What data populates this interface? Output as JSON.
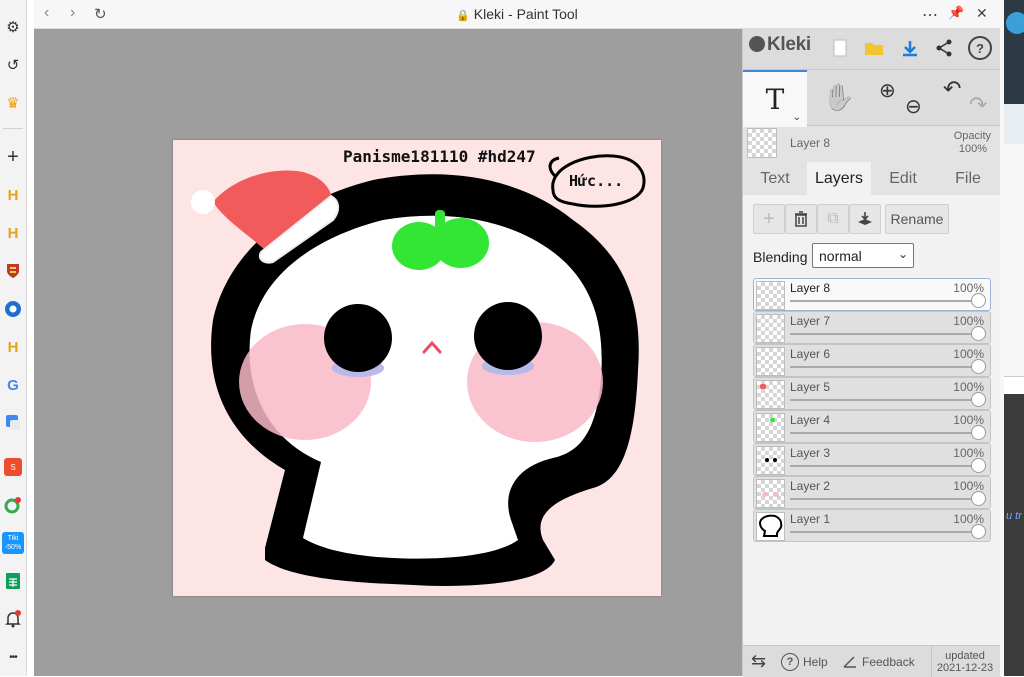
{
  "browser": {
    "window_title": "Kleki - Paint Tool",
    "back_icon": "‹",
    "forward_icon": "›",
    "reload_icon": "↻",
    "lock_icon": "🔒",
    "more_icon": "⋯",
    "pin_icon": "📌",
    "close_icon": "✕",
    "sidebar": {
      "settings_icon": "⚙",
      "history_icon": "↺",
      "crown_icon": "♛",
      "add_icon": "+",
      "more_icon": "•••",
      "h_label": "H",
      "google_label": "G",
      "shop_label": "S",
      "tiki_label": "Tiki",
      "tiki_badge": "-50%",
      "bell_icon": "🔔"
    },
    "right_strip_text": "u tr"
  },
  "app": {
    "logo": "Kleki",
    "top_icons": {
      "new": "new-file-icon",
      "open": "open-folder-icon",
      "save": "download-icon",
      "share": "share-icon",
      "help": "?"
    },
    "tools": {
      "text_tool": "T",
      "hand_tool": "✋",
      "zoom_in": "⊕",
      "zoom_out": "⊖",
      "undo": "↶",
      "redo": "↷"
    },
    "current_layer": {
      "name": "Layer 8",
      "opacity_label": "Opacity",
      "opacity_value": "100%"
    },
    "tabs": [
      "Text",
      "Layers",
      "Edit",
      "File"
    ],
    "active_tab": "Layers",
    "layer_actions": {
      "add": "+",
      "delete": "🗑",
      "duplicate": "⧉",
      "merge": "⬇",
      "rename": "Rename"
    },
    "blending": {
      "label": "Blending",
      "value": "normal"
    },
    "layers": [
      {
        "name": "Layer 8",
        "opacity": "100%",
        "selected": true
      },
      {
        "name": "Layer 7",
        "opacity": "100%",
        "selected": false
      },
      {
        "name": "Layer 6",
        "opacity": "100%",
        "selected": false
      },
      {
        "name": "Layer 5",
        "opacity": "100%",
        "selected": false
      },
      {
        "name": "Layer 4",
        "opacity": "100%",
        "selected": false
      },
      {
        "name": "Layer 3",
        "opacity": "100%",
        "selected": false
      },
      {
        "name": "Layer 2",
        "opacity": "100%",
        "selected": false
      },
      {
        "name": "Layer 1",
        "opacity": "100%",
        "selected": false
      }
    ],
    "footer": {
      "swap_icon": "⇆",
      "help": "Help",
      "feedback": "Feedback",
      "updated_label": "updated",
      "updated_date": "2021-12-23"
    }
  },
  "artwork": {
    "caption": "Panisme181110 #hd247",
    "speech": "Hức...",
    "colors": {
      "background": "#fde4e5",
      "hat": "#f25b5b",
      "sprout": "#33e633",
      "blush": "#f9b8c8",
      "outline": "#000000"
    }
  }
}
